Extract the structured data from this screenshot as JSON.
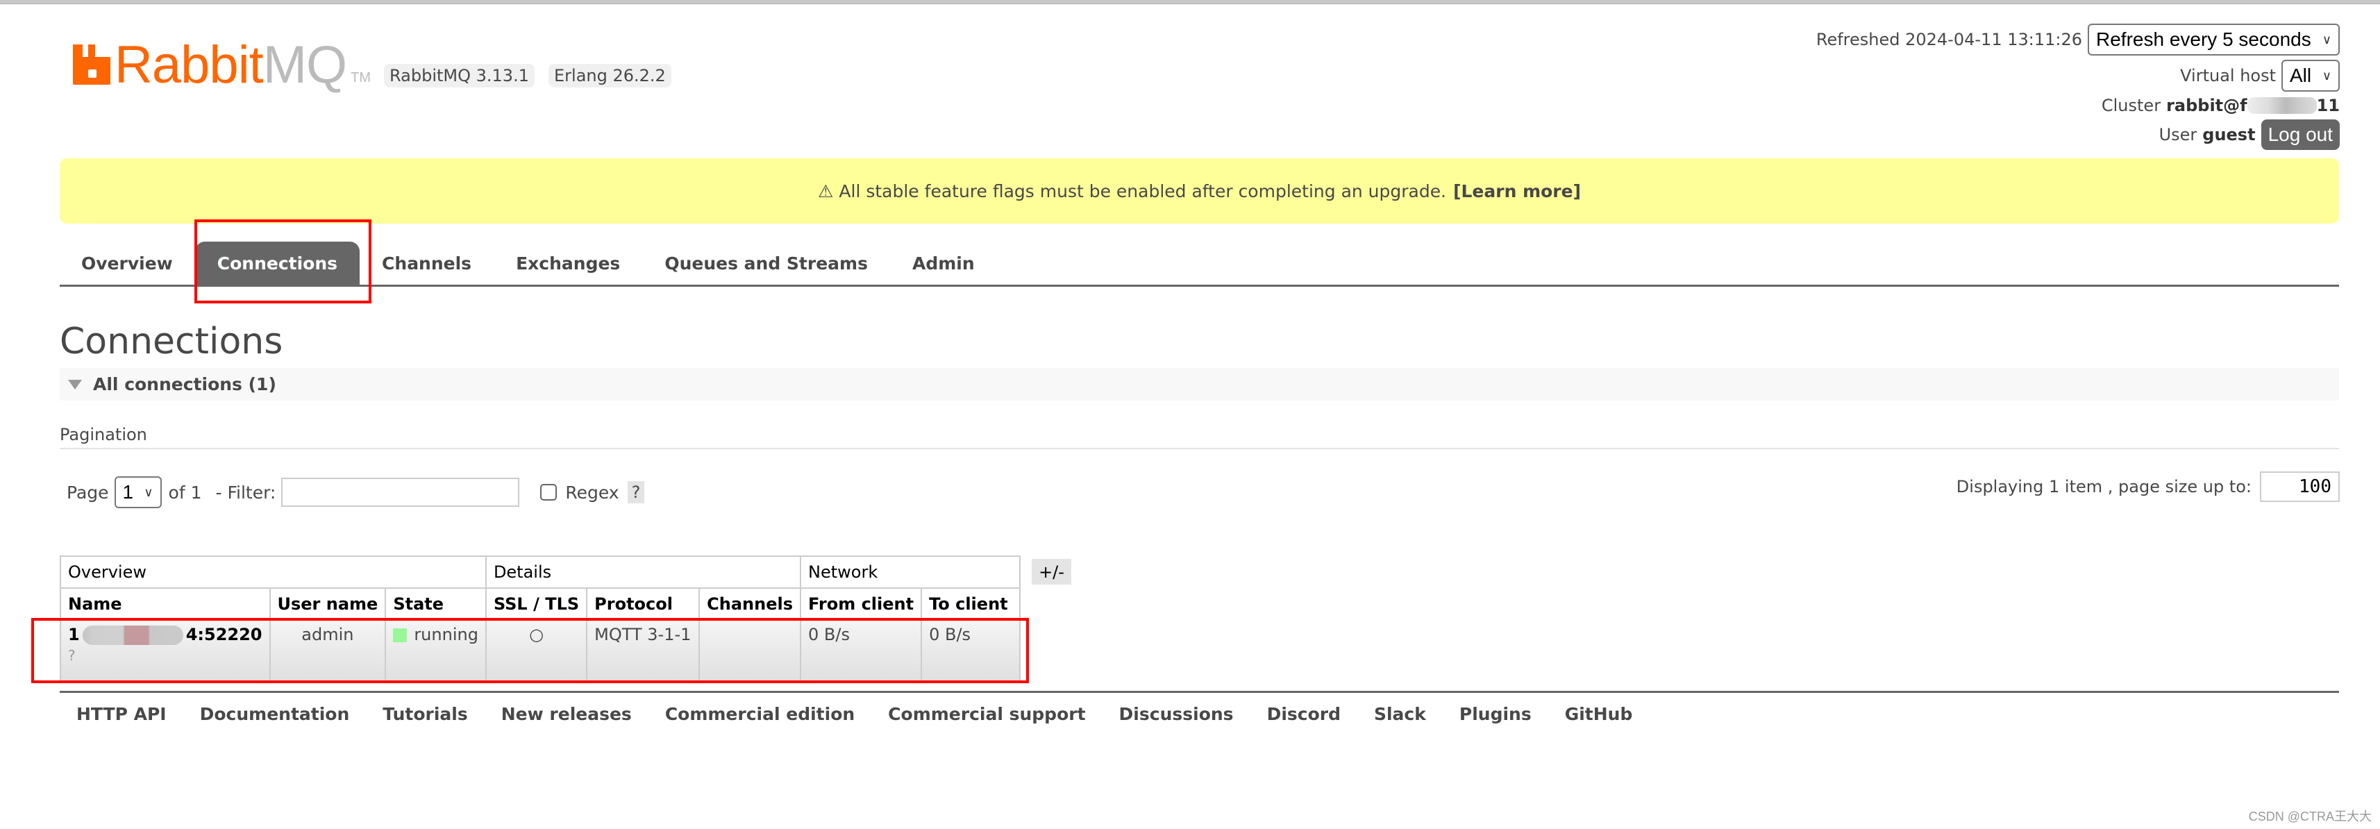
{
  "header": {
    "logo_primary": "Rabbit",
    "logo_secondary": "MQ",
    "logo_tm": "TM",
    "version_badges": [
      "RabbitMQ 3.13.1",
      "Erlang 26.2.2"
    ],
    "refreshed_label": "Refreshed 2024-04-11 13:11:26",
    "refresh_select": "Refresh every 5 seconds",
    "vhost_label": "Virtual host",
    "vhost_select": "All",
    "cluster_label": "Cluster",
    "cluster_name_prefix": "rabbit@f",
    "cluster_name_suffix": "11",
    "user_label": "User",
    "user_name": "guest",
    "logout_label": "Log out"
  },
  "banner": {
    "icon": "⚠",
    "text": "All stable feature flags must be enabled after completing an upgrade.",
    "link": "[Learn more]"
  },
  "tabs": [
    {
      "label": "Overview",
      "active": false
    },
    {
      "label": "Connections",
      "active": true
    },
    {
      "label": "Channels",
      "active": false
    },
    {
      "label": "Exchanges",
      "active": false
    },
    {
      "label": "Queues and Streams",
      "active": false
    },
    {
      "label": "Admin",
      "active": false
    }
  ],
  "page": {
    "title": "Connections",
    "section_title": "All connections (1)"
  },
  "pagination": {
    "label": "Pagination",
    "page_label": "Page",
    "page_value": "1",
    "of_label": "of 1",
    "filter_label": "- Filter:",
    "filter_value": "",
    "regex_label": "Regex",
    "regex_checked": false,
    "help_label": "?",
    "displaying_text": "Displaying 1 item , page size up to:",
    "page_size": "100"
  },
  "table": {
    "groups": [
      "Overview",
      "Details",
      "Network"
    ],
    "columns": [
      "Name",
      "User name",
      "State",
      "SSL / TLS",
      "Protocol",
      "Channels",
      "From client",
      "To client"
    ],
    "toggle_label": "+/-",
    "rows": [
      {
        "name_prefix": "1",
        "name_suffix": "4:52220",
        "name_sub": "?",
        "user": "admin",
        "state": "running",
        "state_color": "#98f898",
        "ssl": "○",
        "protocol": "MQTT 3-1-1",
        "channels": "",
        "from_client": "0 B/s",
        "to_client": "0 B/s"
      }
    ]
  },
  "footer": {
    "links": [
      "HTTP API",
      "Documentation",
      "Tutorials",
      "New releases",
      "Commercial edition",
      "Commercial support",
      "Discussions",
      "Discord",
      "Slack",
      "Plugins",
      "GitHub"
    ]
  },
  "watermark": "CSDN @CTRA王大大",
  "colors": {
    "brand_orange": "#ff6600",
    "banner_yellow": "#ffff99",
    "active_tab": "#666666",
    "highlight_red": "#ff0000"
  }
}
